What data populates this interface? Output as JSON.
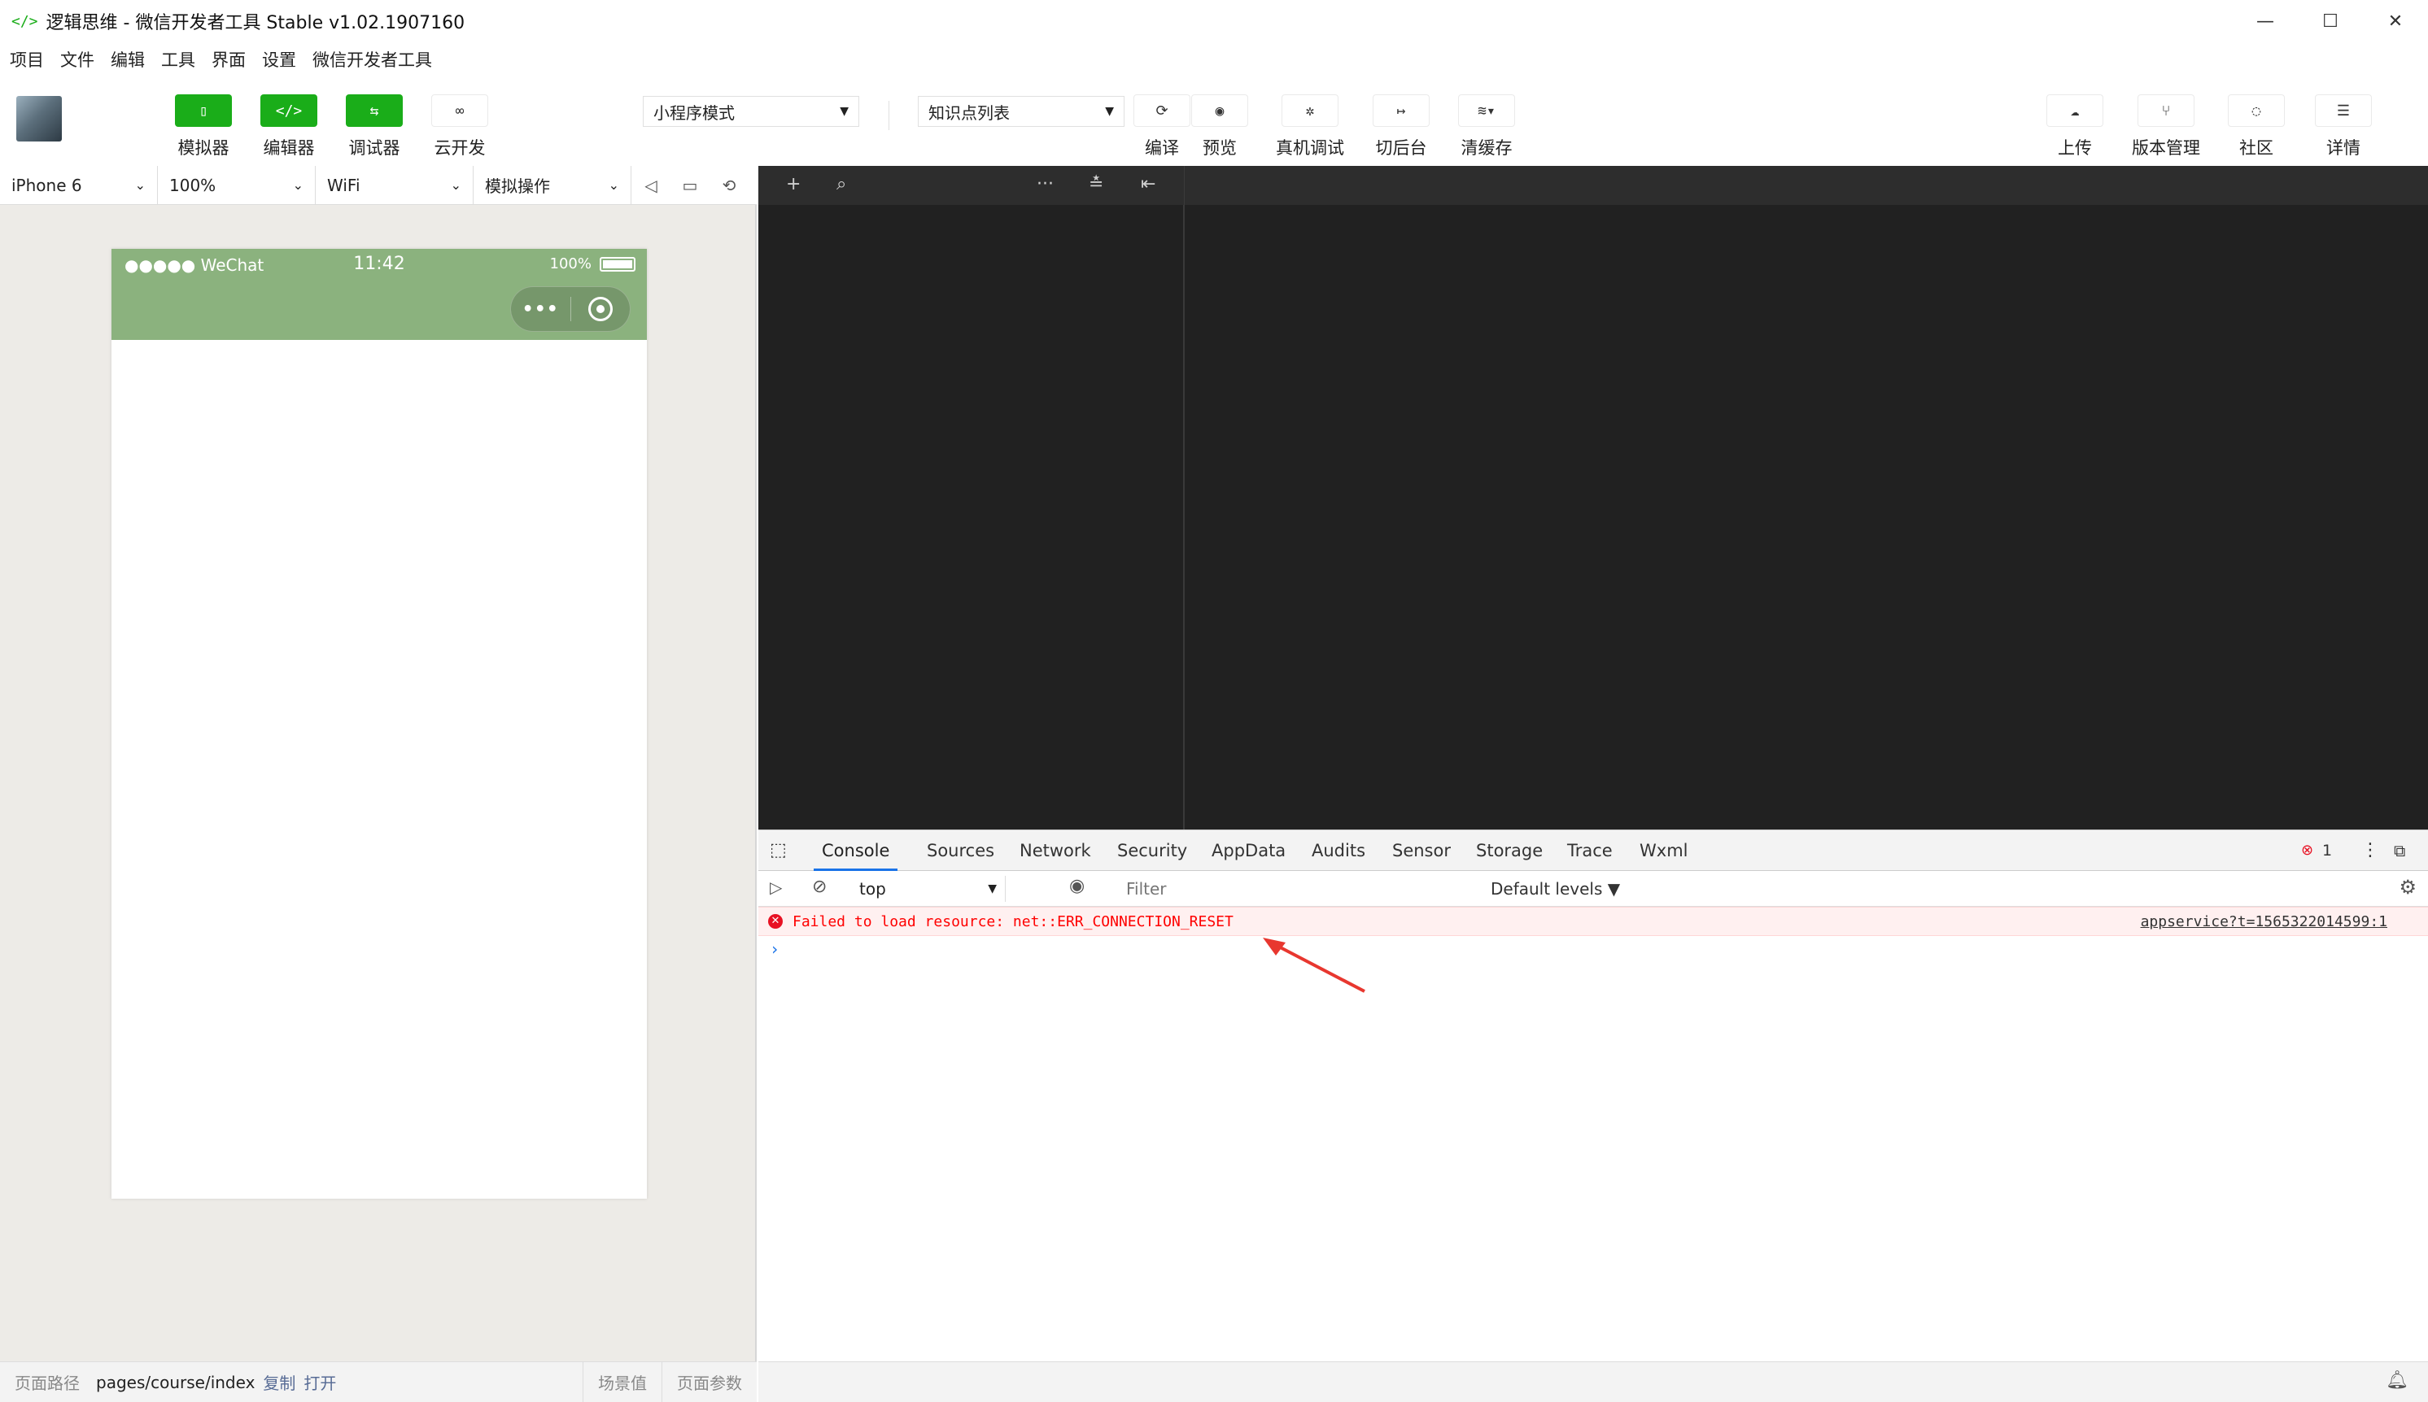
{
  "window": {
    "title": "逻辑思维 - 微信开发者工具 Stable v1.02.1907160",
    "icon": "</>"
  },
  "menu": [
    "项目",
    "文件",
    "编辑",
    "工具",
    "界面",
    "设置",
    "微信开发者工具"
  ],
  "toolbar": {
    "left_buttons": [
      {
        "label": "模拟器",
        "icon": "phone-icon"
      },
      {
        "label": "编辑器",
        "icon": "code-icon"
      },
      {
        "label": "调试器",
        "icon": "debug-icon"
      },
      {
        "label": "云开发",
        "icon": "cloud-link-icon"
      }
    ],
    "mode_select": "小程序模式",
    "compile_select": "知识点列表",
    "mid_buttons": [
      {
        "label": "编译",
        "icon": "refresh-icon"
      },
      {
        "label": "预览",
        "icon": "eye-icon"
      },
      {
        "label": "真机调试",
        "icon": "bug-icon"
      },
      {
        "label": "切后台",
        "icon": "switch-icon"
      },
      {
        "label": "清缓存",
        "icon": "layers-icon"
      }
    ],
    "right_buttons": [
      {
        "label": "上传",
        "icon": "upload-icon"
      },
      {
        "label": "版本管理",
        "icon": "branch-icon"
      },
      {
        "label": "社区",
        "icon": "chat-icon"
      },
      {
        "label": "详情",
        "icon": "menu-icon"
      }
    ]
  },
  "simulator": {
    "device": "iPhone 6",
    "zoom": "100%",
    "network": "WiFi",
    "ops": "模拟操作",
    "phone": {
      "signal": "●●●●● WeChat",
      "time": "11:42",
      "battery": "100%",
      "header_color": "#8bb27e"
    },
    "footer": {
      "path_label": "页面路径",
      "path": "pages/course/index",
      "copy": "复制",
      "open": "打开",
      "scene": "场景值",
      "params": "页面参数"
    }
  },
  "devtools": {
    "tabs": [
      "Console",
      "Sources",
      "Network",
      "Security",
      "AppData",
      "Audits",
      "Sensor",
      "Storage",
      "Trace",
      "Wxml"
    ],
    "active_tab": "Console",
    "error_count": "1",
    "context": "top",
    "filter_placeholder": "Filter",
    "levels": "Default levels ▼",
    "error": {
      "message": "Failed to load resource: net::ERR_CONNECTION_RESET",
      "source": "appservice?t=1565322014599:1"
    },
    "prompt": "›"
  }
}
